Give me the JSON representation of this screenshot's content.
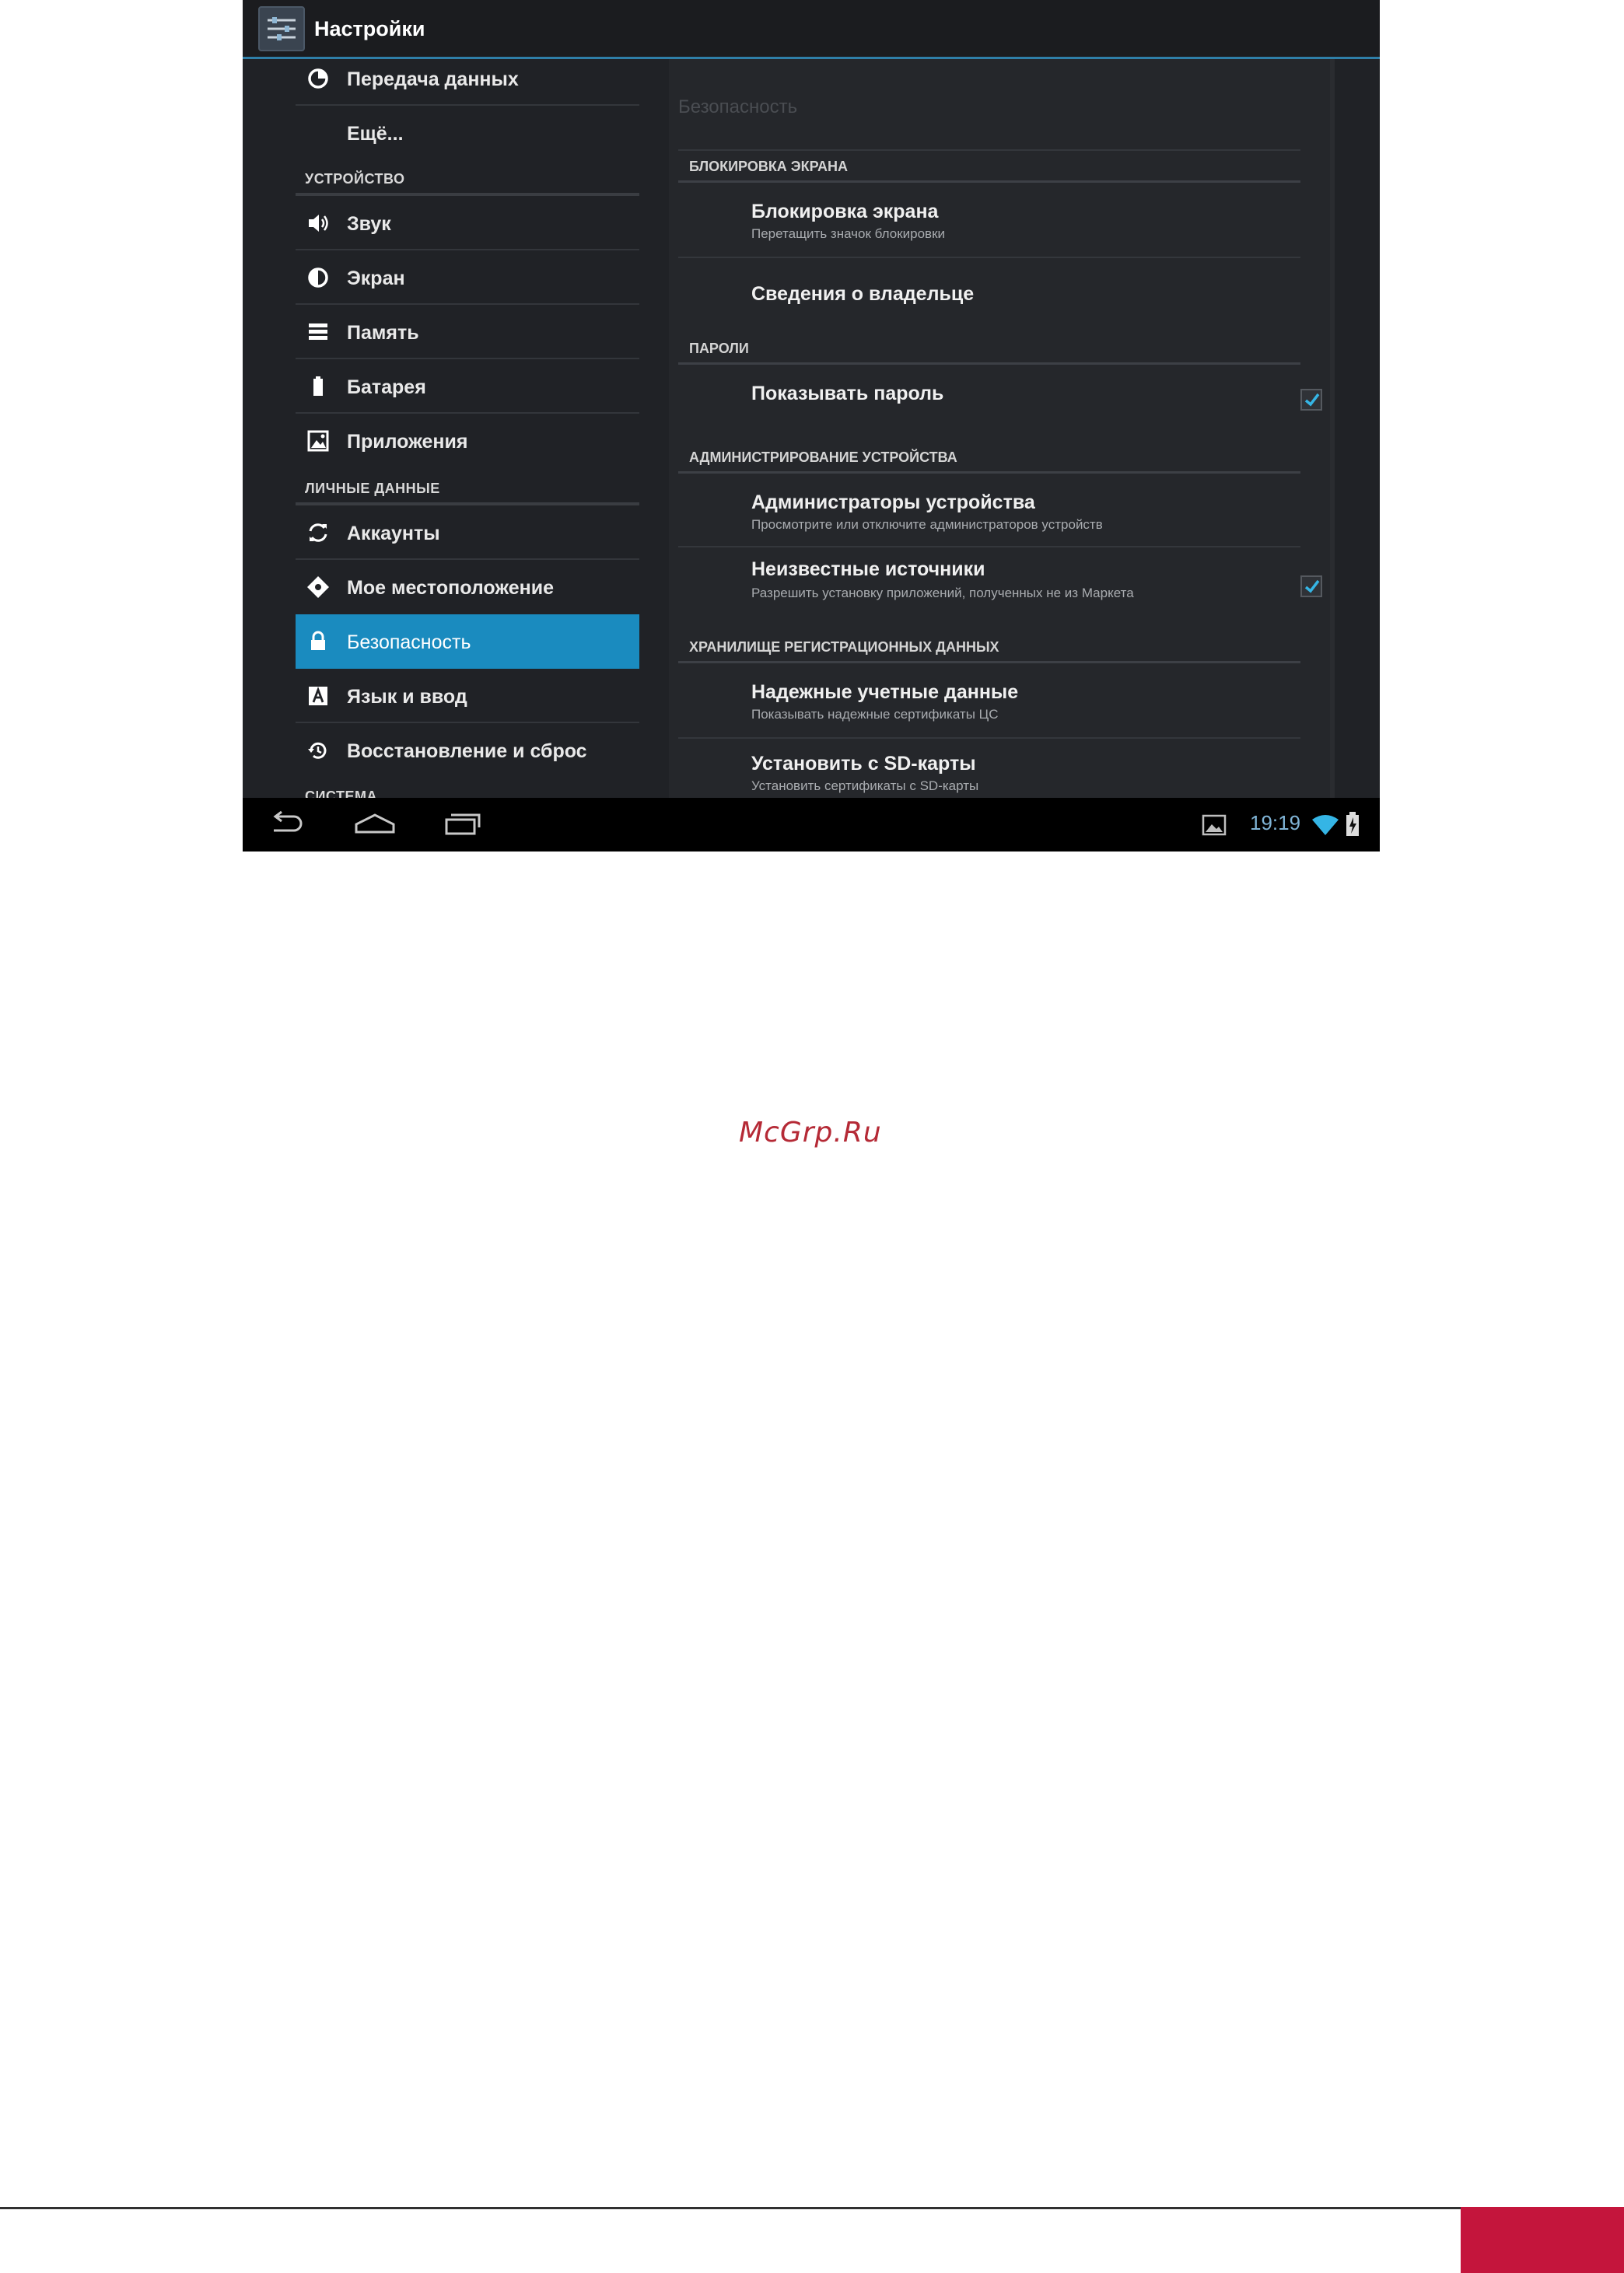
{
  "app": {
    "title": "Настройки"
  },
  "sidebar": {
    "items": [
      {
        "label": "Передача данных",
        "icon": "data-usage-icon"
      },
      {
        "label": "Ещё..."
      },
      {
        "header": "УСТРОЙСТВО"
      },
      {
        "label": "Звук",
        "icon": "speaker-icon"
      },
      {
        "label": "Экран",
        "icon": "display-icon"
      },
      {
        "label": "Память",
        "icon": "storage-icon"
      },
      {
        "label": "Батарея",
        "icon": "battery-icon"
      },
      {
        "label": "Приложения",
        "icon": "apps-icon"
      },
      {
        "header": "ЛИЧНЫЕ ДАННЫЕ"
      },
      {
        "label": "Аккаунты",
        "icon": "sync-icon"
      },
      {
        "label": "Мое местоположение",
        "icon": "location-icon"
      },
      {
        "label": "Безопасность",
        "icon": "lock-icon",
        "selected": true
      },
      {
        "label": "Язык и ввод",
        "icon": "keyboard-icon"
      },
      {
        "label": "Восстановление и сброс",
        "icon": "restore-icon"
      },
      {
        "header": "СИСТЕМА"
      }
    ]
  },
  "main": {
    "title": "Безопасность",
    "sections": [
      {
        "header": "БЛОКИРОВКА ЭКРАНА",
        "items": [
          {
            "title": "Блокировка экрана",
            "summary": "Перетащить значок блокировки"
          },
          {
            "title": "Сведения о владельце"
          }
        ]
      },
      {
        "header": "ПАРОЛИ",
        "items": [
          {
            "title": "Показывать пароль",
            "checked": true
          }
        ]
      },
      {
        "header": "АДМИНИСТРИРОВАНИЕ УСТРОЙСТВА",
        "items": [
          {
            "title": "Администраторы устройства",
            "summary": "Просмотрите или отключите администраторов устройств"
          },
          {
            "title": "Неизвестные источники",
            "summary": "Разрешить установку приложений, полученных не из Маркета",
            "checked": true
          }
        ]
      },
      {
        "header": "ХРАНИЛИЩЕ РЕГИСТРАЦИОННЫХ ДАННЫХ",
        "items": [
          {
            "title": "Надежные учетные данные",
            "summary": "Показывать надежные сертификаты ЦС"
          },
          {
            "title": "Установить с SD-карты",
            "summary": "Установить сертификаты с SD-карты"
          }
        ]
      }
    ]
  },
  "statusbar": {
    "time": "19:19"
  },
  "page": {
    "watermark": "McGrp.Ru"
  },
  "colors": {
    "accent": "#1a8bbf",
    "clock": "#7fb3d5",
    "check": "#35b5e5",
    "footer": "#c4153c",
    "watermark": "#b52a36"
  }
}
